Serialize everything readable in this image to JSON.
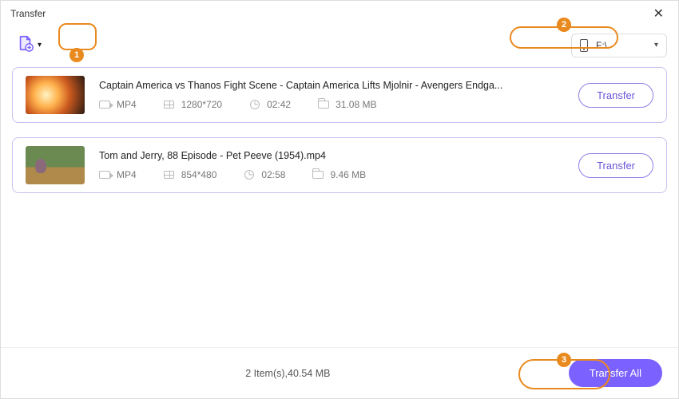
{
  "window": {
    "title": "Transfer"
  },
  "toolbar": {
    "add_label": "Add file",
    "destination": {
      "label": "F:\\"
    }
  },
  "items": [
    {
      "title": "Captain America vs Thanos Fight Scene - Captain America Lifts Mjolnir - Avengers Endga...",
      "format": "MP4",
      "resolution": "1280*720",
      "duration": "02:42",
      "size": "31.08 MB",
      "action": "Transfer",
      "thumb": "a"
    },
    {
      "title": "Tom and Jerry, 88 Episode - Pet Peeve (1954).mp4",
      "format": "MP4",
      "resolution": "854*480",
      "duration": "02:58",
      "size": "9.46 MB",
      "action": "Transfer",
      "thumb": "b"
    }
  ],
  "footer": {
    "summary": "2 Item(s),40.54 MB",
    "transfer_all": "Transfer All"
  },
  "annotations": {
    "1": "1",
    "2": "2",
    "3": "3"
  }
}
